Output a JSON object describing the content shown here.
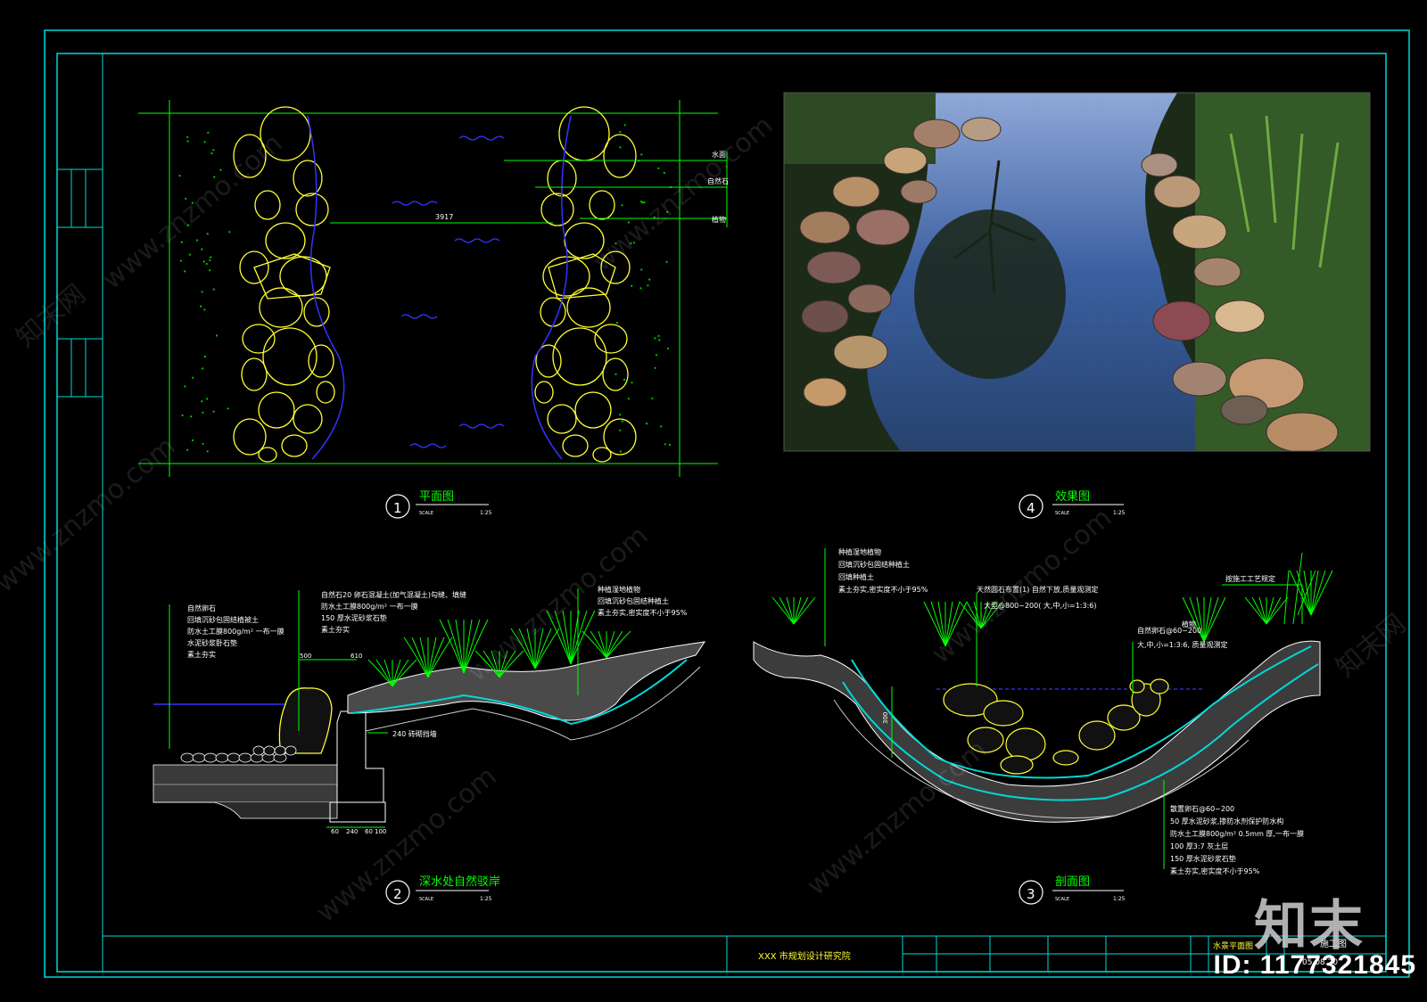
{
  "plan": {
    "number": "1",
    "title": "平面图",
    "scale_label": "SCALE",
    "scale": "1:25",
    "dimension": "3917",
    "callouts": [
      "水面",
      "自然石",
      "植物"
    ]
  },
  "photo": {
    "number": "4",
    "title": "效果图",
    "scale_label": "SCALE",
    "scale": "1:25"
  },
  "revetment": {
    "number": "2",
    "title": "深水处自然驳岸",
    "scale_label": "SCALE",
    "scale": "1:25",
    "left_notes": [
      "自然卵石",
      "回填沉砂包固结植被土",
      "防水土工膜800g/m²  一布一膜",
      "水泥砂浆卧石垫",
      "素土夯实"
    ],
    "mid_notes": [
      "自然石20  卵石混凝土(加气混凝土)勾缝、填缝",
      "防水土工膜800g/m²  一布一膜",
      "150 厚水泥砂浆石垫",
      "素土夯实"
    ],
    "right_notes": [
      "种植湿地植物",
      "回填沉砂包固结种植土",
      "素土夯实,密实度不小于95%"
    ],
    "dim_500": "500",
    "dim_610": "610",
    "wall_note": "240  砖砌挡墙",
    "bottom_dims": [
      "60",
      "240",
      "60",
      "100"
    ]
  },
  "section": {
    "number": "3",
    "title": "剖面图",
    "scale_label": "SCALE",
    "scale": "1:25",
    "left_notes": [
      "种植湿地植物",
      "回填沉砂包固结种植土",
      "回填种植土",
      "素土夯实,密实度不小于95%"
    ],
    "stone_note_title": "天然圆石布置(1) 自然下放,质量观测定",
    "stone_note_size": "大型@800~200(  大,中,小=1:3:6)",
    "stone_note2_title": "自然卵石@60~200",
    "stone_note2_size": "大,中,小=1:3:6,  质量观测定",
    "plant_note": "植物",
    "construction_note": "按施工工艺规定",
    "depth_dim": "300",
    "bottom_notes": [
      "散置卵石@60~200",
      "50 厚水泥砂浆,掺防水剂保护防水构",
      "防水土工膜800g/m²  0.5mm  厚,一布一膜",
      "100 厚3:7 灰土层",
      "150 厚水泥砂浆石垫",
      "素土夯实,密实度不小于95%"
    ]
  },
  "titleblock": {
    "institute": "XXX 市规划设计研究院",
    "drawing_name": "水景平面图",
    "stage": "施工图",
    "date": "05.08.20"
  },
  "watermark": {
    "brand": "知末",
    "id_text": "ID: 1177321845",
    "site": "www.znzmo.com",
    "site_cn": "知末网"
  },
  "colors": {
    "frame": "#00d8d8",
    "green": "#00ff00",
    "yellow": "#ffff33",
    "white": "#ffffff",
    "blue": "#3333ff"
  }
}
